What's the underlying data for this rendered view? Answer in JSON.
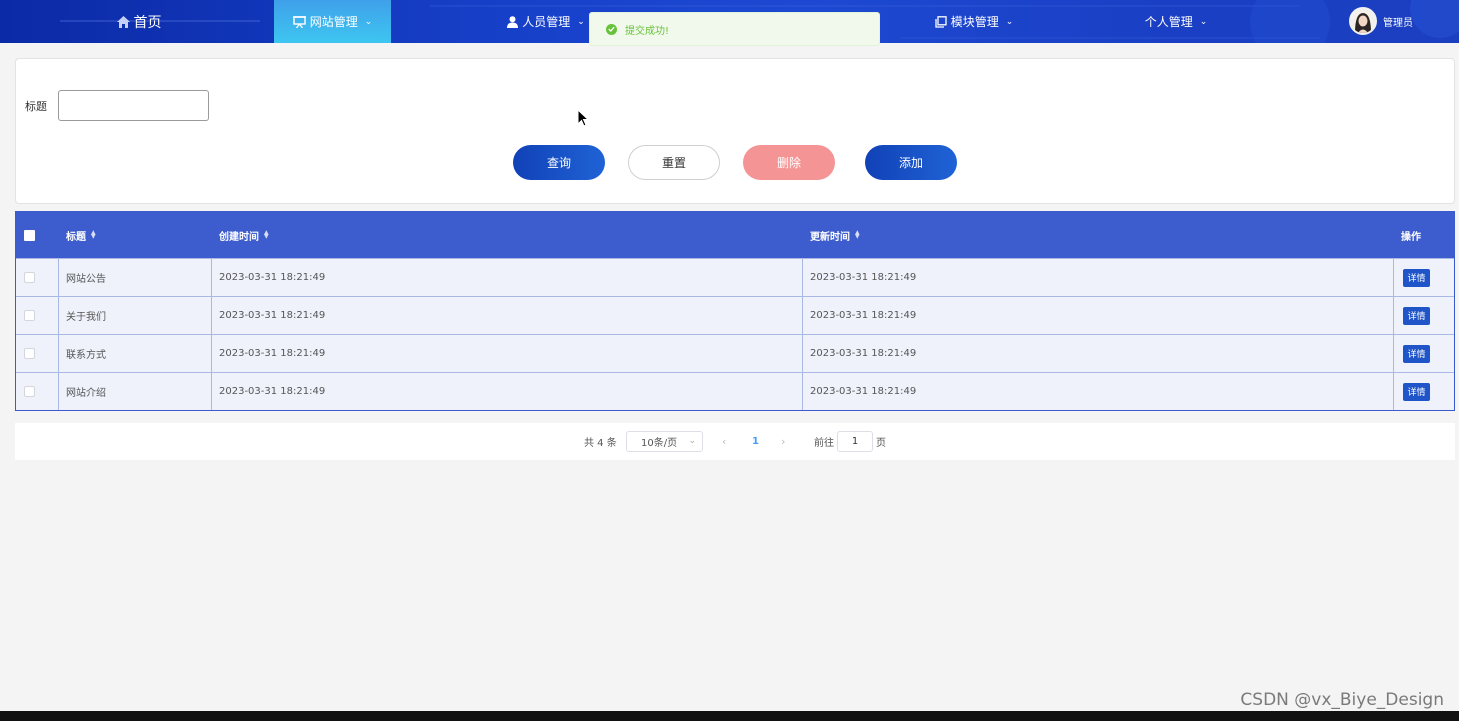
{
  "nav": {
    "home": "首页",
    "website_mgmt": "网站管理",
    "staff_mgmt": "人员管理",
    "module_mgmt": "模块管理",
    "personal_mgmt": "个人管理",
    "user_name": "管理员"
  },
  "toast": {
    "message": "提交成功!"
  },
  "search": {
    "title_label": "标题",
    "title_value": "",
    "query_btn": "查询",
    "reset_btn": "重置",
    "delete_btn": "删除",
    "add_btn": "添加"
  },
  "table": {
    "headers": {
      "title": "标题",
      "created": "创建时间",
      "updated": "更新时间",
      "action": "操作"
    },
    "rows": [
      {
        "title": "网站公告",
        "created": "2023-03-31 18:21:49",
        "updated": "2023-03-31 18:21:49",
        "action": "详情"
      },
      {
        "title": "关于我们",
        "created": "2023-03-31 18:21:49",
        "updated": "2023-03-31 18:21:49",
        "action": "详情"
      },
      {
        "title": "联系方式",
        "created": "2023-03-31 18:21:49",
        "updated": "2023-03-31 18:21:49",
        "action": "详情"
      },
      {
        "title": "网站介绍",
        "created": "2023-03-31 18:21:49",
        "updated": "2023-03-31 18:21:49",
        "action": "详情"
      }
    ]
  },
  "pagination": {
    "total": "共 4 条",
    "page_size": "10条/页",
    "current_page": "1",
    "goto_label": "前往",
    "goto_value": "1",
    "page_suffix": "页"
  },
  "watermark": "CSDN @vx_Biye_Design",
  "colors": {
    "nav_bg": "#1740c9",
    "active_tab": "#3ec6f0",
    "table_header": "#3d5ccd",
    "primary_button": "#1141b7",
    "delete_button": "#f59495",
    "success": "#67c23a"
  }
}
